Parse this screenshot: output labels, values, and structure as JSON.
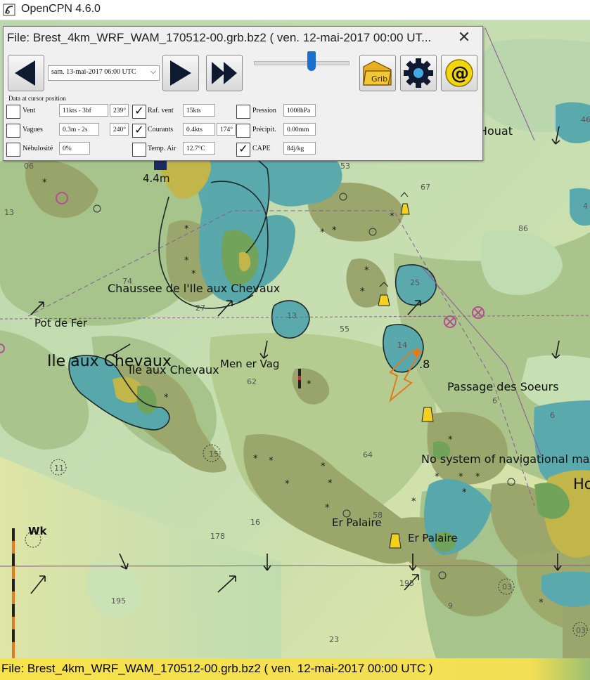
{
  "app": {
    "title": "OpenCPN 4.6.0"
  },
  "grib_dialog": {
    "title": "File: Brest_4km_WRF_WAM_170512-00.grb.bz2 ( ven. 12-mai-2017 00:00  UT...",
    "selected_time": "sam. 13-mai-2017 06:00  UTC",
    "timeline_position_fraction": 0.6,
    "data_caption": "Data at cursor position",
    "fields": {
      "vent": {
        "label": "Vent",
        "checked": false,
        "value": "11kts - 3bf",
        "direction": "239°"
      },
      "raf_vent": {
        "label": "Raf. vent",
        "checked": true,
        "value": "15kts"
      },
      "pression": {
        "label": "Pression",
        "checked": false,
        "value": "1008hPa"
      },
      "vagues": {
        "label": "Vagues",
        "checked": false,
        "value": "0.3m - 2s",
        "direction": "240°"
      },
      "courants": {
        "label": "Courants",
        "checked": true,
        "value": "0.4kts",
        "direction": "174°"
      },
      "precipit": {
        "label": "Précipit.",
        "checked": false,
        "value": "0.00mm"
      },
      "nebulosite": {
        "label": "Nébulosité",
        "checked": false,
        "value": "0%"
      },
      "temp_air": {
        "label": "Temp. Air",
        "checked": false,
        "value": "12.7°C"
      },
      "cape": {
        "label": "CAPE",
        "checked": true,
        "value": "84j/kg"
      }
    },
    "toolbar": {
      "grib_file_icon_text": "Grib",
      "at_icon_text": "@"
    },
    "check_mark": "✓",
    "close_glyph": "✕",
    "chevron_glyph": "⌵"
  },
  "chart": {
    "place_labels": [
      {
        "text": "Chaussee de l'Ile aux Chevaux"
      },
      {
        "text": "Pot de Fer"
      },
      {
        "text": "Ile aux Chevaux"
      },
      {
        "text": "Ile aux Chevaux"
      },
      {
        "text": "Men er Vag"
      },
      {
        "text": "Passage des Soeurs"
      },
      {
        "text": "No system of navigational ma"
      },
      {
        "text": "Er Palaire"
      },
      {
        "text": "Er Palaire"
      },
      {
        "text": "e Houat"
      },
      {
        "text": "Ho"
      },
      {
        "text": "Wk"
      },
      {
        "text": "4.4m"
      },
      {
        "text": ".8"
      }
    ],
    "depths": [
      "13",
      "74",
      "27",
      "13",
      "55",
      "53",
      "67",
      "86",
      "25",
      "14",
      "62",
      "64",
      "15",
      "11",
      "16",
      "178",
      "58",
      "195",
      "195",
      "23",
      "9",
      "03",
      "03",
      "06",
      "6",
      "6",
      "46",
      "4"
    ]
  },
  "status_bar": {
    "text": "File: Brest_4km_WRF_WAM_170512-00.grb.bz2 ( ven. 12-mai-2017 00:00  UTC )"
  },
  "colors": {
    "land_shallow": "#a9c48d",
    "deep_water": "#c7dcb0",
    "rock_olive": "#97a46a",
    "drying_teal": "#56a8ad",
    "land_green": "#71a35a",
    "land_yellow": "#c2b54a",
    "status_yellow": "#f2df55",
    "slider_blue": "#1a6fd0"
  }
}
